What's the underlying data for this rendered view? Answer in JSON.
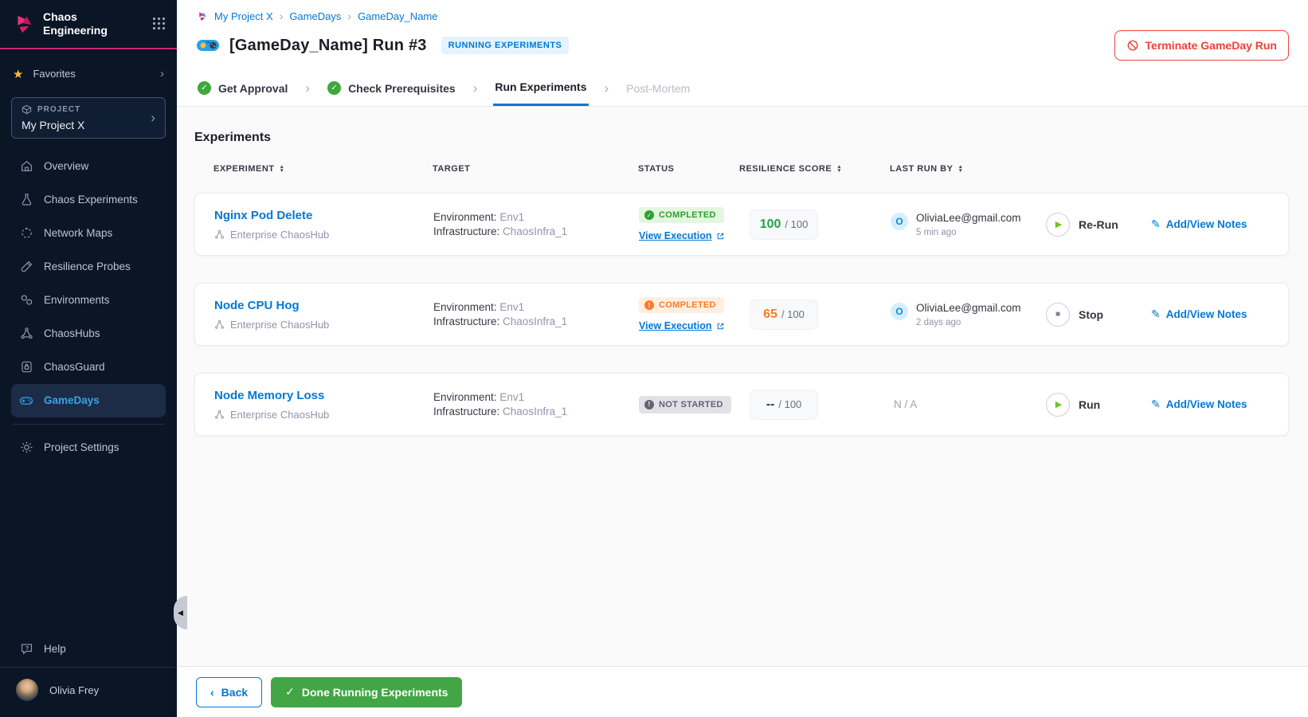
{
  "colors": {
    "accent_blue": "#0278D5",
    "brand_pink": "#D5246E",
    "success_green": "#2F9E34",
    "warning_orange": "#FF7B26",
    "danger_red": "#EE4238",
    "done_green": "#42A546",
    "sidebar_bg": "#0A1526",
    "active_nav_blue": "#35A4E8"
  },
  "icons": {
    "star": "★",
    "chevron_right": "›",
    "chevron_left": "‹",
    "check": "✓",
    "exclaim": "!",
    "play": "▶",
    "stop": "■",
    "sort_up": "▲",
    "sort_down": "▼",
    "pencil": "✎",
    "collapse": "◀"
  },
  "sidebar": {
    "brand": "Chaos Engineering",
    "favorites": "Favorites",
    "project_label": "PROJECT",
    "project_name": "My Project X",
    "nav": [
      {
        "label": "Overview"
      },
      {
        "label": "Chaos Experiments"
      },
      {
        "label": "Network Maps"
      },
      {
        "label": "Resilience Probes"
      },
      {
        "label": "Environments"
      },
      {
        "label": "ChaosHubs"
      },
      {
        "label": "ChaosGuard"
      },
      {
        "label": "GameDays"
      }
    ],
    "project_settings": "Project Settings",
    "help": "Help",
    "user_name": "Olivia Frey"
  },
  "header": {
    "breadcrumb": [
      "My Project X",
      "GameDays",
      "GameDay_Name"
    ],
    "title": "[GameDay_Name] Run #3",
    "badge": "RUNNING EXPERIMENTS",
    "terminate": "Terminate GameDay Run"
  },
  "stepper": [
    "Get Approval",
    "Check Prerequisites",
    "Run Experiments",
    "Post-Mortem"
  ],
  "main": {
    "section_title": "Experiments",
    "columns": [
      "EXPERIMENT",
      "TARGET",
      "STATUS",
      "RESILIENCE SCORE",
      "LAST RUN BY"
    ],
    "rows": [
      {
        "name": "Nginx Pod Delete",
        "hub": "Enterprise ChaosHub",
        "env_label": "Environment:",
        "env_value": "Env1",
        "infra_label": "Infrastructure:",
        "infra_value": "ChaosInfra_1",
        "status": "COMPLETED",
        "view_execution": "View Execution",
        "score": "100",
        "score_suffix": "/ 100",
        "user_initial": "O",
        "user_email": "OliviaLee@gmail.com",
        "last_run_time": "5 min ago",
        "action": "Re-Run",
        "notes": "Add/View Notes"
      },
      {
        "name": "Node CPU Hog",
        "hub": "Enterprise ChaosHub",
        "env_label": "Environment:",
        "env_value": "Env1",
        "infra_label": "Infrastructure:",
        "infra_value": "ChaosInfra_1",
        "status": "COMPLETED",
        "view_execution": "View Execution",
        "score": "65",
        "score_suffix": "/ 100",
        "user_initial": "O",
        "user_email": "OliviaLee@gmail.com",
        "last_run_time": "2 days ago",
        "action": "Stop",
        "notes": "Add/View Notes"
      },
      {
        "name": "Node Memory Loss",
        "hub": "Enterprise ChaosHub",
        "env_label": "Environment:",
        "env_value": "Env1",
        "infra_label": "Infrastructure:",
        "infra_value": "ChaosInfra_1",
        "status": "NOT STARTED",
        "score": "--",
        "score_suffix": "/ 100",
        "last_run_na": "N / A",
        "action": "Run",
        "notes": "Add/View Notes"
      }
    ]
  },
  "footer": {
    "back": "Back",
    "done": "Done Running Experiments"
  }
}
